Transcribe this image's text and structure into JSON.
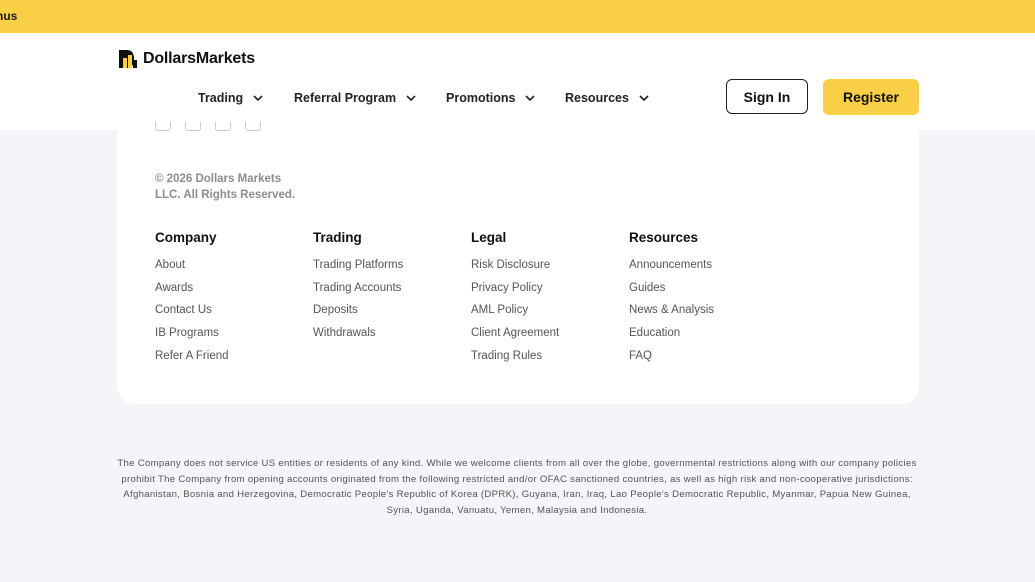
{
  "banner": {
    "text": "nus"
  },
  "header": {
    "logo_text": "DollarsMarkets",
    "nav": [
      {
        "label": "Trading"
      },
      {
        "label": "Referral Program"
      },
      {
        "label": "Promotions"
      },
      {
        "label": "Resources"
      }
    ],
    "sign_in_label": "Sign In",
    "register_label": "Register"
  },
  "footer": {
    "copyright_line1": "© 2026 Dollars Markets",
    "copyright_line2": "LLC. All Rights Reserved.",
    "columns": [
      {
        "title": "Company",
        "links": [
          "About",
          "Awards",
          "Contact Us",
          "IB Programs",
          "Refer A Friend"
        ]
      },
      {
        "title": "Trading",
        "links": [
          "Trading Platforms",
          "Trading Accounts",
          "Deposits",
          "Withdrawals"
        ]
      },
      {
        "title": "Legal",
        "links": [
          "Risk Disclosure",
          "Privacy Policy",
          "AML Policy",
          "Client Agreement",
          "Trading Rules"
        ]
      },
      {
        "title": "Resources",
        "links": [
          "Announcements",
          "Guides",
          "News & Analysis",
          "Education",
          "FAQ"
        ]
      }
    ],
    "disclaimer": "The Company does not service US entities or residents of any kind. While we welcome clients from all over the globe, governmental restrictions along with our company policies prohibit The Company from opening accounts originated from the following restricted and/or OFAC sanctioned countries, as well as high risk and non-cooperative jurisdictions: Afghanistan, Bosnia and Herzegovina, Democratic People's Republic of Korea (DPRK), Guyana, Iran, Iraq, Lao People's Democratic Republic, Myanmar, Papua New Guinea, Syria, Uganda, Vanuatu, Yemen, Malaysia and Indonesia."
  },
  "colors": {
    "accent": "#f8cf45",
    "background": "#f4f4f9"
  }
}
